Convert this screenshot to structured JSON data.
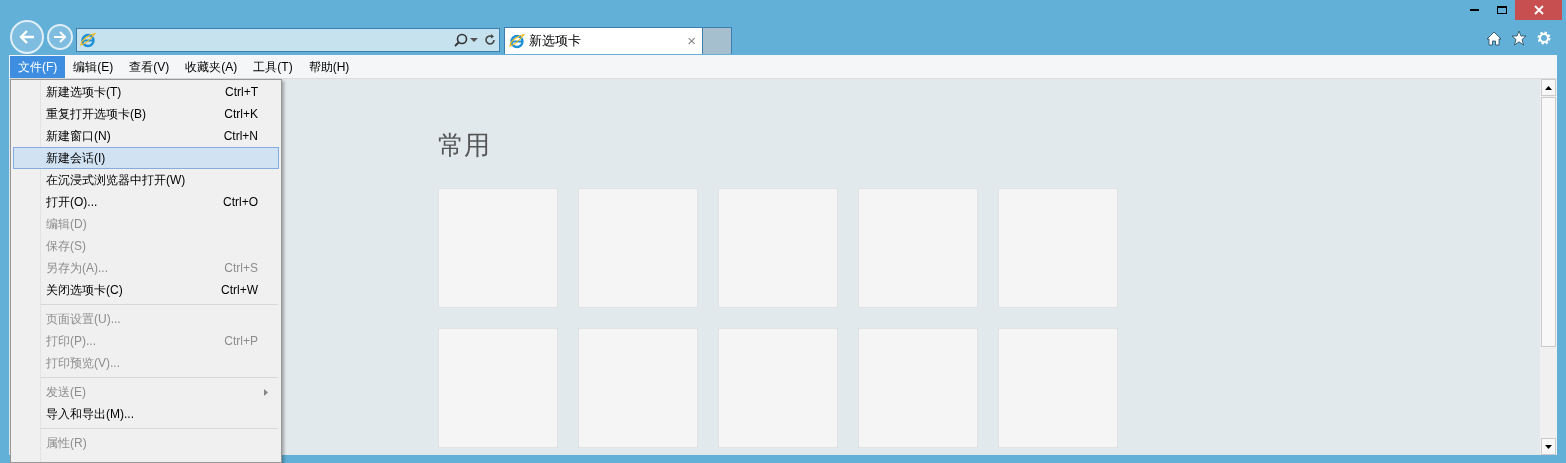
{
  "tabs": [
    {
      "label": "新选项卡",
      "selected": true,
      "close": "×"
    }
  ],
  "menu_bar": [
    {
      "label": "文件(F)",
      "selected": true
    },
    {
      "label": "编辑(E)",
      "selected": false
    },
    {
      "label": "查看(V)",
      "selected": false
    },
    {
      "label": "收藏夹(A)",
      "selected": false
    },
    {
      "label": "工具(T)",
      "selected": false
    },
    {
      "label": "帮助(H)",
      "selected": false
    }
  ],
  "file_menu": [
    {
      "kind": "item",
      "label": "新建选项卡(T)",
      "shortcut": "Ctrl+T",
      "disabled": false,
      "selected": false
    },
    {
      "kind": "item",
      "label": "重复打开选项卡(B)",
      "shortcut": "Ctrl+K",
      "disabled": false,
      "selected": false
    },
    {
      "kind": "item",
      "label": "新建窗口(N)",
      "shortcut": "Ctrl+N",
      "disabled": false,
      "selected": false
    },
    {
      "kind": "item",
      "label": "新建会话(I)",
      "disabled": false,
      "selected": true
    },
    {
      "kind": "item",
      "label": "在沉浸式浏览器中打开(W)",
      "disabled": false,
      "selected": false
    },
    {
      "kind": "item",
      "label": "打开(O)...",
      "shortcut": "Ctrl+O",
      "disabled": false,
      "selected": false
    },
    {
      "kind": "item",
      "label": "编辑(D)",
      "disabled": true,
      "selected": false
    },
    {
      "kind": "item",
      "label": "保存(S)",
      "disabled": true,
      "selected": false
    },
    {
      "kind": "item",
      "label": "另存为(A)...",
      "shortcut": "Ctrl+S",
      "disabled": true,
      "selected": false
    },
    {
      "kind": "item",
      "label": "关闭选项卡(C)",
      "shortcut": "Ctrl+W",
      "disabled": false,
      "selected": false
    },
    {
      "kind": "separator"
    },
    {
      "kind": "item",
      "label": "页面设置(U)...",
      "disabled": true,
      "selected": false
    },
    {
      "kind": "item",
      "label": "打印(P)...",
      "shortcut": "Ctrl+P",
      "disabled": true,
      "selected": false
    },
    {
      "kind": "item",
      "label": "打印预览(V)...",
      "disabled": true,
      "selected": false
    },
    {
      "kind": "separator"
    },
    {
      "kind": "submenu",
      "label": "发送(E)",
      "disabled": true,
      "selected": false
    },
    {
      "kind": "item",
      "label": "导入和导出(M)...",
      "disabled": false,
      "selected": false
    },
    {
      "kind": "separator"
    },
    {
      "kind": "item",
      "label": "属性(R)",
      "disabled": true,
      "selected": false
    }
  ],
  "page": {
    "heading": "常用"
  }
}
